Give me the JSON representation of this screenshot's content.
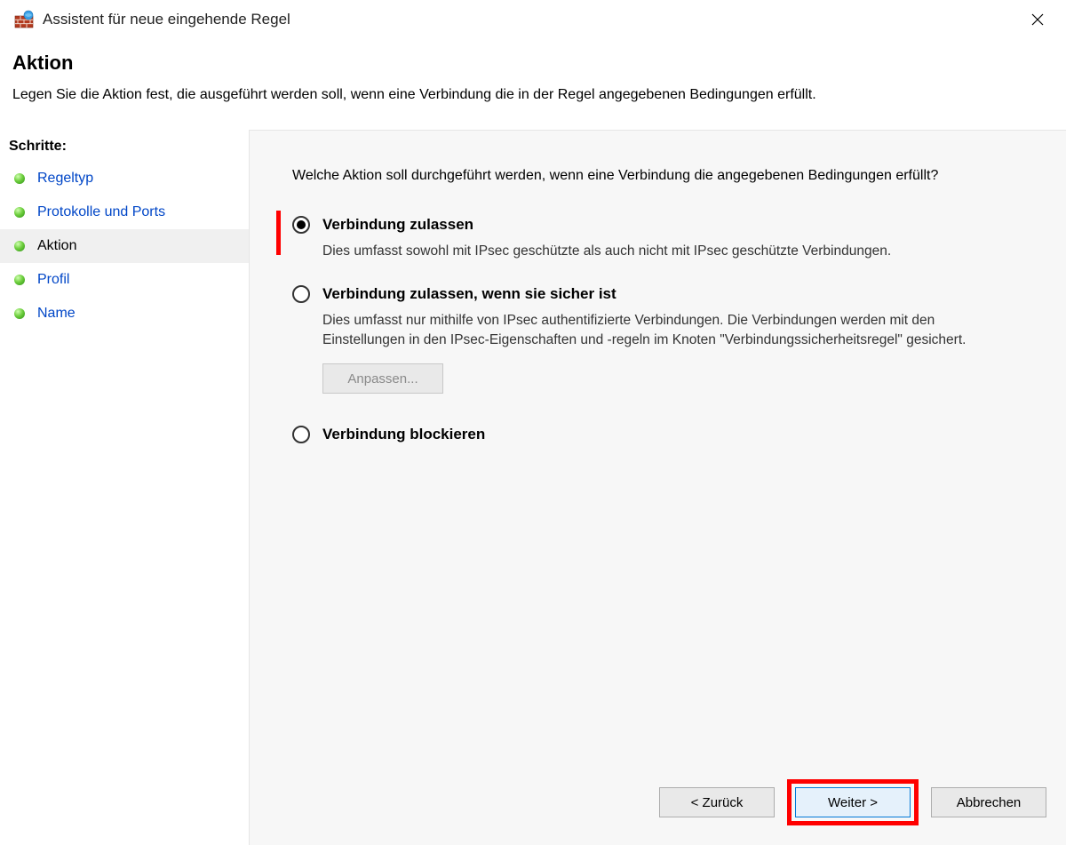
{
  "window": {
    "title": "Assistent für neue eingehende Regel"
  },
  "header": {
    "title": "Aktion",
    "description": "Legen Sie die Aktion fest, die ausgeführt werden soll, wenn eine Verbindung die in der Regel angegebenen Bedingungen erfüllt."
  },
  "sidebar": {
    "steps_label": "Schritte:",
    "items": [
      {
        "label": "Regeltyp",
        "current": false
      },
      {
        "label": "Protokolle und Ports",
        "current": false
      },
      {
        "label": "Aktion",
        "current": true
      },
      {
        "label": "Profil",
        "current": false
      },
      {
        "label": "Name",
        "current": false
      }
    ]
  },
  "content": {
    "prompt": "Welche Aktion soll durchgeführt werden, wenn eine Verbindung die angegebenen Bedingungen erfüllt?",
    "options": [
      {
        "title": "Verbindung zulassen",
        "description": "Dies umfasst sowohl mit IPsec geschützte als auch nicht mit IPsec geschützte Verbindungen.",
        "selected": true,
        "highlighted": true
      },
      {
        "title": "Verbindung zulassen, wenn sie sicher ist",
        "description": "Dies umfasst nur mithilfe von IPsec authentifizierte Verbindungen. Die Verbindungen werden mit den Einstellungen in den IPsec-Eigenschaften und -regeln im Knoten \"Verbindungssicherheitsregel\" gesichert.",
        "selected": false,
        "customize_label": "Anpassen...",
        "customize_enabled": false
      },
      {
        "title": "Verbindung blockieren",
        "description": "",
        "selected": false
      }
    ]
  },
  "footer": {
    "back_label": "< Zurück",
    "next_label": "Weiter >",
    "cancel_label": "Abbrechen",
    "next_highlighted": true
  }
}
